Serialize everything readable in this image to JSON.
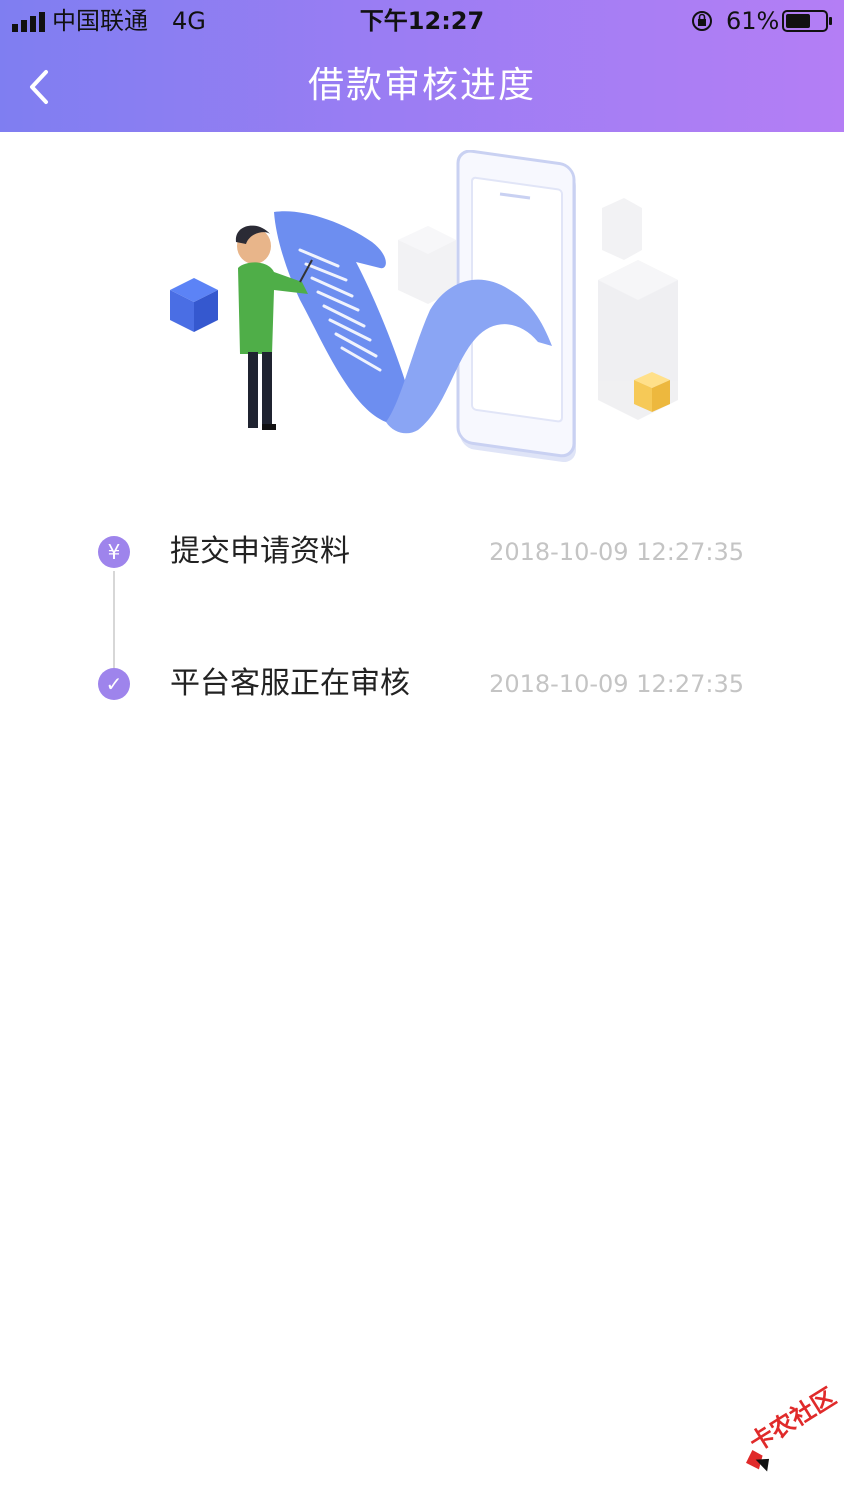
{
  "status_bar": {
    "carrier": "中国联通",
    "network": "4G",
    "time": "下午12:27",
    "battery_percent": "61%",
    "icons": [
      "signal-icon",
      "orientation-lock-icon",
      "battery-icon"
    ]
  },
  "nav": {
    "title": "借款审核进度",
    "back_icon": "chevron-left-icon"
  },
  "colors": {
    "header_start": "#7f7ef1",
    "header_end": "#b47ef5",
    "accent": "#9e84ec",
    "time_text": "#c4c4c4"
  },
  "timeline": {
    "steps": [
      {
        "icon": "yen-icon",
        "icon_glyph": "¥",
        "label": "提交申请资料",
        "time": "2018-10-09 12:27:35"
      },
      {
        "icon": "check-icon",
        "icon_glyph": "✓",
        "label": "平台客服正在审核",
        "time": "2018-10-09 12:27:35"
      }
    ]
  },
  "watermark": {
    "text": "卡农社区"
  }
}
